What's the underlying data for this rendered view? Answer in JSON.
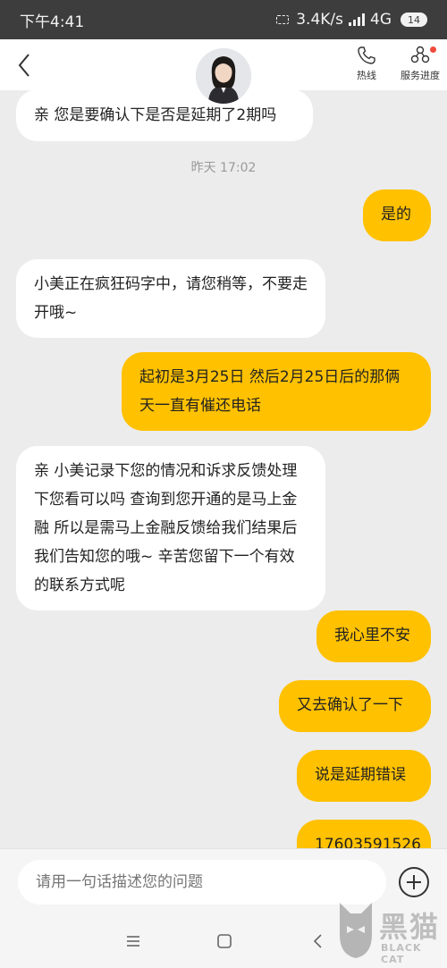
{
  "status_bar": {
    "time": "下午4:41",
    "speed": "3.4K/s",
    "network": "4G",
    "battery": "14"
  },
  "header": {
    "hotline_label": "热线",
    "progress_label": "服务进度"
  },
  "messages": [
    {
      "side": "in",
      "text": "亲 您是要确认下是否是延期了2期吗"
    },
    {
      "side": "time",
      "text": "昨天 17:02"
    },
    {
      "side": "out",
      "text": "是的"
    },
    {
      "side": "in",
      "text": "小美正在疯狂码字中，请您稍等，不要走开哦~"
    },
    {
      "side": "out",
      "text": "起初是3月25日 然后2月25日后的那俩天一直有催还电话"
    },
    {
      "side": "in",
      "text": "亲 小美记录下您的情况和诉求反馈处理下您看可以吗 查询到您开通的是马上金融 所以是需马上金融反馈给我们结果后 我们告知您的哦~ 辛苦您留下一个有效的联系方式呢"
    },
    {
      "side": "out",
      "text": "我心里不安"
    },
    {
      "side": "out",
      "text": "又去确认了一下"
    },
    {
      "side": "out",
      "text": "说是延期错误"
    },
    {
      "side": "out",
      "text": "17603591526"
    }
  ],
  "input": {
    "placeholder": "请用一句话描述您的问题"
  },
  "watermark": {
    "text": "黑猫",
    "sub": "BLACK CAT"
  },
  "colors": {
    "accent": "#ffc100",
    "status_bar": "#3d3d3d",
    "background": "#ececec"
  }
}
